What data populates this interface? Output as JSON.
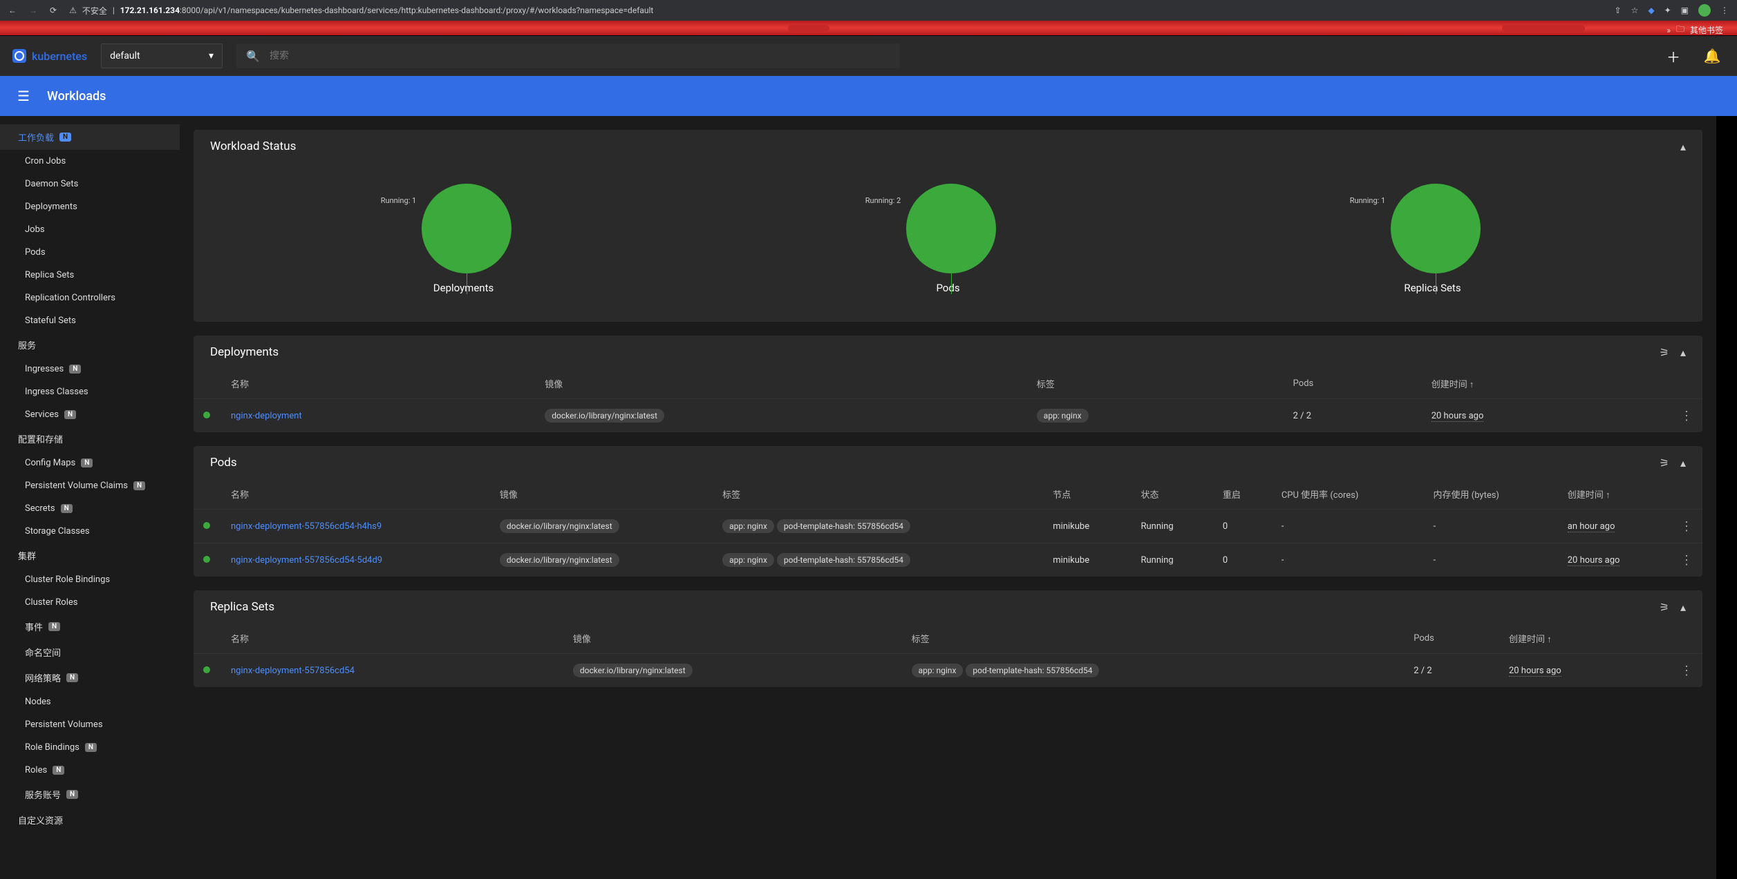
{
  "browser": {
    "insecure": "不安全",
    "url_host": "172.21.161.234",
    "url_rest": ":8000/api/v1/namespaces/kubernetes-dashboard/services/http:kubernetes-dashboard:/proxy/#/workloads?namespace=default",
    "more": "»",
    "bookmarks": "其他书签"
  },
  "header": {
    "brand": "kubernetes",
    "namespace": "default",
    "search_placeholder": "搜索"
  },
  "bluebar": {
    "title": "Workloads"
  },
  "sidebar": {
    "sections": [
      {
        "title": "工作负载",
        "active": true,
        "badge": "N",
        "items": [
          {
            "label": "Cron Jobs"
          },
          {
            "label": "Daemon Sets"
          },
          {
            "label": "Deployments"
          },
          {
            "label": "Jobs"
          },
          {
            "label": "Pods"
          },
          {
            "label": "Replica Sets"
          },
          {
            "label": "Replication Controllers"
          },
          {
            "label": "Stateful Sets"
          }
        ]
      },
      {
        "title": "服务",
        "items": [
          {
            "label": "Ingresses",
            "badge": "N"
          },
          {
            "label": "Ingress Classes"
          },
          {
            "label": "Services",
            "badge": "N"
          }
        ]
      },
      {
        "title": "配置和存储",
        "items": [
          {
            "label": "Config Maps",
            "badge": "N"
          },
          {
            "label": "Persistent Volume Claims",
            "badge": "N"
          },
          {
            "label": "Secrets",
            "badge": "N"
          },
          {
            "label": "Storage Classes"
          }
        ]
      },
      {
        "title": "集群",
        "items": [
          {
            "label": "Cluster Role Bindings"
          },
          {
            "label": "Cluster Roles"
          },
          {
            "label": "事件",
            "badge": "N"
          },
          {
            "label": "命名空间"
          },
          {
            "label": "网络策略",
            "badge": "N"
          },
          {
            "label": "Nodes"
          },
          {
            "label": "Persistent Volumes"
          },
          {
            "label": "Role Bindings",
            "badge": "N"
          },
          {
            "label": "Roles",
            "badge": "N"
          },
          {
            "label": "服务账号",
            "badge": "N"
          }
        ]
      },
      {
        "title": "自定义资源",
        "items": []
      }
    ]
  },
  "status_card": {
    "title": "Workload Status"
  },
  "chart_data": [
    {
      "type": "pie",
      "title": "Deployments",
      "categories": [
        "Running"
      ],
      "values": [
        1
      ],
      "label": "Running: 1"
    },
    {
      "type": "pie",
      "title": "Pods",
      "categories": [
        "Running"
      ],
      "values": [
        2
      ],
      "label": "Running: 2"
    },
    {
      "type": "pie",
      "title": "Replica Sets",
      "categories": [
        "Running"
      ],
      "values": [
        1
      ],
      "label": "Running: 1"
    }
  ],
  "deployments": {
    "title": "Deployments",
    "cols": [
      "名称",
      "镜像",
      "标签",
      "Pods",
      "创建时间 ↑"
    ],
    "rows": [
      {
        "name": "nginx-deployment",
        "image": "docker.io/library/nginx:latest",
        "labels": [
          "app: nginx"
        ],
        "pods": "2 / 2",
        "created": "20 hours ago"
      }
    ]
  },
  "pods": {
    "title": "Pods",
    "cols": [
      "名称",
      "镜像",
      "标签",
      "节点",
      "状态",
      "重启",
      "CPU 使用率 (cores)",
      "内存使用 (bytes)",
      "创建时间 ↑"
    ],
    "rows": [
      {
        "name": "nginx-deployment-557856cd54-h4hs9",
        "image": "docker.io/library/nginx:latest",
        "labels": [
          "app: nginx",
          "pod-template-hash: 557856cd54"
        ],
        "node": "minikube",
        "status": "Running",
        "restarts": "0",
        "cpu": "-",
        "mem": "-",
        "created": "an hour ago"
      },
      {
        "name": "nginx-deployment-557856cd54-5d4d9",
        "image": "docker.io/library/nginx:latest",
        "labels": [
          "app: nginx",
          "pod-template-hash: 557856cd54"
        ],
        "node": "minikube",
        "status": "Running",
        "restarts": "0",
        "cpu": "-",
        "mem": "-",
        "created": "20 hours ago"
      }
    ]
  },
  "replicasets": {
    "title": "Replica Sets",
    "cols": [
      "名称",
      "镜像",
      "标签",
      "Pods",
      "创建时间 ↑"
    ],
    "rows": [
      {
        "name": "nginx-deployment-557856cd54",
        "image": "docker.io/library/nginx:latest",
        "labels": [
          "app: nginx",
          "pod-template-hash: 557856cd54"
        ],
        "pods": "2 / 2",
        "created": "20 hours ago"
      }
    ]
  }
}
